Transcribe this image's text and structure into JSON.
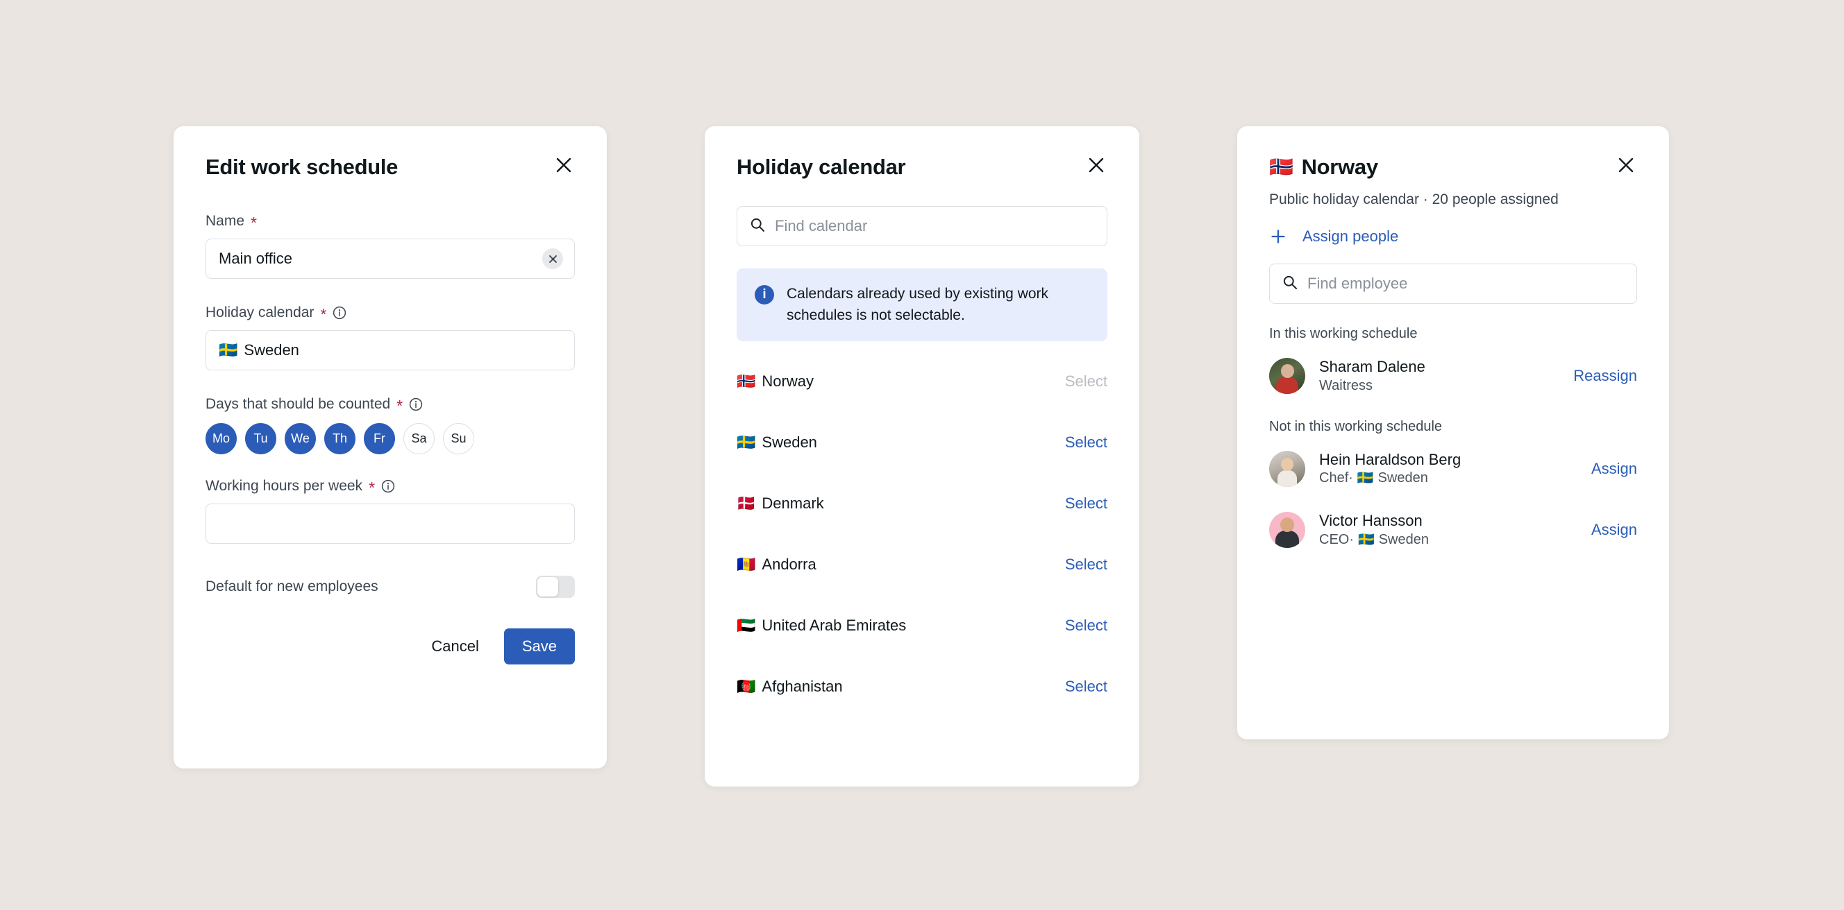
{
  "edit_dialog": {
    "title": "Edit work schedule",
    "close_icon": "close-icon",
    "name": {
      "label": "Name",
      "required_mark": "*",
      "value": "Main office",
      "clear_icon": "close-icon"
    },
    "holiday_calendar": {
      "label": "Holiday calendar",
      "required_mark": "*",
      "info_icon": "info-icon",
      "flag": "🇸🇪",
      "value": "Sweden"
    },
    "days": {
      "label": "Days that should be counted",
      "required_mark": "*",
      "info_icon": "info-icon",
      "items": [
        {
          "label": "Mo",
          "selected": true
        },
        {
          "label": "Tu",
          "selected": true
        },
        {
          "label": "We",
          "selected": true
        },
        {
          "label": "Th",
          "selected": true
        },
        {
          "label": "Fr",
          "selected": true
        },
        {
          "label": "Sa",
          "selected": false
        },
        {
          "label": "Su",
          "selected": false
        }
      ]
    },
    "working_hours": {
      "label": "Working hours per week",
      "required_mark": "*",
      "info_icon": "info-icon",
      "value": ""
    },
    "default_toggle": {
      "label": "Default for new employees",
      "state": "off"
    },
    "cancel_label": "Cancel",
    "save_label": "Save"
  },
  "calendar_dialog": {
    "title": "Holiday calendar",
    "close_icon": "close-icon",
    "search": {
      "icon": "search-icon",
      "placeholder": "Find calendar",
      "value": ""
    },
    "notice": {
      "icon": "info-icon",
      "text": "Calendars already used by existing work schedules is not selectable."
    },
    "rows": [
      {
        "flag": "🇳🇴",
        "name": "Norway",
        "action": "Select",
        "disabled": true
      },
      {
        "flag": "🇸🇪",
        "name": "Sweden",
        "action": "Select",
        "disabled": false
      },
      {
        "flag": "🇩🇰",
        "name": "Denmark",
        "action": "Select",
        "disabled": false
      },
      {
        "flag": "🇦🇩",
        "name": "Andorra",
        "action": "Select",
        "disabled": false
      },
      {
        "flag": "🇦🇪",
        "name": "United Arab Emirates",
        "action": "Select",
        "disabled": false
      },
      {
        "flag": "🇦🇫",
        "name": "Afghanistan",
        "action": "Select",
        "disabled": false
      }
    ]
  },
  "norway_dialog": {
    "flag": "🇳🇴",
    "title": "Norway",
    "close_icon": "close-icon",
    "subtitle": "Public holiday calendar · 20 people assigned",
    "assign_people": {
      "icon": "plus-icon",
      "label": "Assign people"
    },
    "search": {
      "icon": "search-icon",
      "placeholder": "Find employee",
      "value": ""
    },
    "group_in": {
      "heading": "In this working schedule",
      "people": [
        {
          "name": "Sharam Dalene",
          "role": "Waitress",
          "flag": "",
          "country": "",
          "action": "Reassign",
          "avatar": "avatar-sharam-dalene"
        }
      ]
    },
    "group_out": {
      "heading": "Not in this working schedule",
      "people": [
        {
          "name": "Hein Haraldson Berg",
          "role": "Chef",
          "separator": "·",
          "flag": "🇸🇪",
          "country": "Sweden",
          "action": "Assign",
          "avatar": "avatar-hein-haraldson-berg"
        },
        {
          "name": "Victor Hansson",
          "role": "CEO",
          "separator": "·",
          "flag": "🇸🇪",
          "country": "Sweden",
          "action": "Assign",
          "avatar": "avatar-victor-hansson"
        }
      ]
    }
  },
  "colors": {
    "page_background": "#eae5e1",
    "accent_blue": "#2b5cb8",
    "required_red": "#b4254c",
    "info_banner_background": "#e7edfc",
    "text_primary": "#11181c",
    "text_secondary": "#3d4650",
    "border": "#dcdfe3",
    "disabled_link": "#b9bdc2"
  }
}
